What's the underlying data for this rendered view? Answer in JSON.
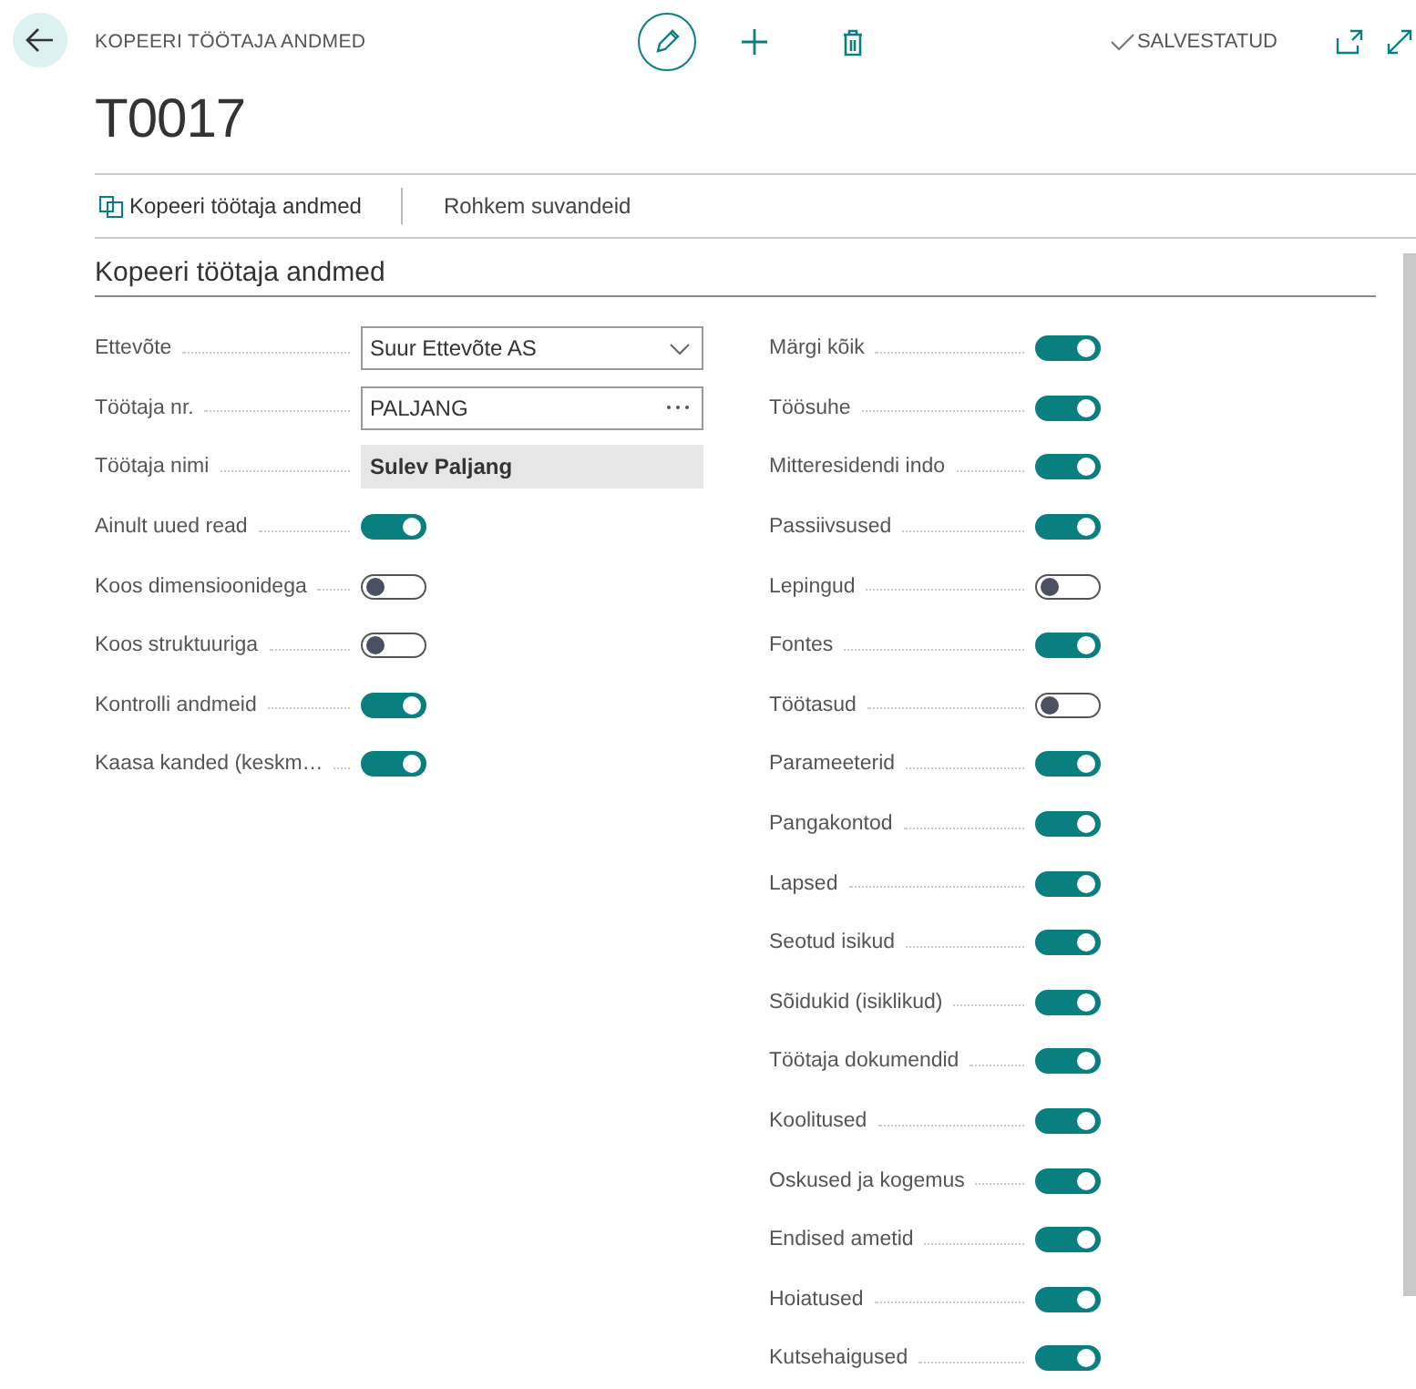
{
  "header": {
    "caption": "KOPEERI TÖÖTAJA ANDMED",
    "title": "T0017",
    "status": "SALVESTATUD"
  },
  "actions": [
    "Kopeeri töötaja andmed",
    "Rohkem suvandeid"
  ],
  "section": {
    "title": "Kopeeri töötaja andmed"
  },
  "left_fields": [
    {
      "kind": "dropdown",
      "label": "Ettevõte",
      "value": "Suur Ettevõte AS"
    },
    {
      "kind": "lookup",
      "label": "Töötaja nr.",
      "value": "PALJANG"
    },
    {
      "kind": "readonly",
      "label": "Töötaja nimi",
      "value": "Sulev Paljang"
    },
    {
      "kind": "toggle",
      "label": "Ainult uued read",
      "on": true
    },
    {
      "kind": "toggle",
      "label": "Koos dimensioonidega",
      "on": false
    },
    {
      "kind": "toggle",
      "label": "Koos struktuuriga",
      "on": false
    },
    {
      "kind": "toggle",
      "label": "Kontrolli andmeid",
      "on": true
    },
    {
      "kind": "toggle",
      "label": "Kaasa kanded (keskm…",
      "on": true
    }
  ],
  "right_fields": [
    {
      "label": "Märgi kõik",
      "on": true
    },
    {
      "label": "Töösuhe",
      "on": true
    },
    {
      "label": "Mitteresidendi indo",
      "on": true
    },
    {
      "label": "Passiivsused",
      "on": true
    },
    {
      "label": "Lepingud",
      "on": false
    },
    {
      "label": "Fontes",
      "on": true
    },
    {
      "label": "Töötasud",
      "on": false
    },
    {
      "label": "Parameeterid",
      "on": true
    },
    {
      "label": "Pangakontod",
      "on": true
    },
    {
      "label": "Lapsed",
      "on": true
    },
    {
      "label": "Seotud isikud",
      "on": true
    },
    {
      "label": "Sõidukid (isiklikud)",
      "on": true
    },
    {
      "label": "Töötaja dokumendid",
      "on": true
    },
    {
      "label": "Koolitused",
      "on": true
    },
    {
      "label": "Oskused ja kogemus",
      "on": true
    },
    {
      "label": "Endised ametid",
      "on": true
    },
    {
      "label": "Hoiatused",
      "on": true
    },
    {
      "label": "Kutsehaigused",
      "on": true
    }
  ]
}
